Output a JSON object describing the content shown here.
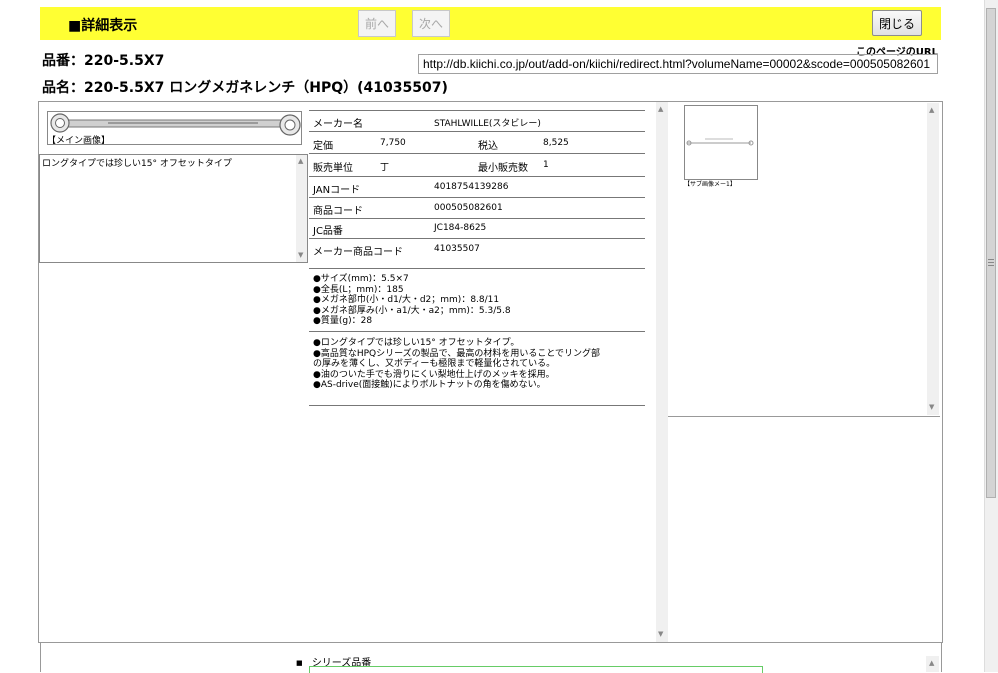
{
  "header": {
    "title": "■詳細表示",
    "prev_label": "前へ",
    "next_label": "次へ",
    "close_label": "閉じる"
  },
  "product": {
    "part_no_line": "品番：220-5.5X7",
    "part_name_line": "品名：220-5.5X7 ロングメガネレンチ（HPQ）(41035507)"
  },
  "url": {
    "label": "このページのURL",
    "value": "http://db.kiichi.co.jp/out/add-on/kiichi/redirect.html?volumeName=00002&scode=000505082601"
  },
  "main_image": {
    "caption": "【メイン画像】"
  },
  "description": "ロングタイプでは珍しい15° オフセットタイプ",
  "specs": {
    "maker_label": "メーカー名",
    "maker_value": "STAHLWILLE(スタビレー)",
    "list_price_label": "定価",
    "list_price_value": "7,750",
    "tax_in_label": "税込",
    "tax_in_value": "8,525",
    "unit_label": "販売単位",
    "unit_value": "丁",
    "min_qty_label": "最小販売数",
    "min_qty_value": "1",
    "jan_label": "JANコード",
    "jan_value": "4018754139286",
    "product_code_label": "商品コード",
    "product_code_value": "000505082601",
    "jc_label": "JC品番",
    "jc_value": "JC184-8625",
    "maker_code_label": "メーカー商品コード",
    "maker_code_value": "41035507"
  },
  "dimensions": [
    "●サイズ(mm)：5.5×7",
    "●全長(L；mm)：185",
    "●メガネ部巾(小・d1/大・d2；mm)：8.8/11",
    "●メガネ部厚み(小・a1/大・a2；mm)：5.3/5.8",
    "●質量(g)：28"
  ],
  "features": [
    "●ロングタイプでは珍しい15° オフセットタイプ。",
    "●高品質なHPQシリーズの製品で、最高の材料を用いることでリング部",
    "の厚みを薄くし、又ボディーも極限まで軽量化されている。",
    "●油のついた手でも滑りにくい梨地仕上げのメッキを採用。",
    "●AS-drive(面接触)によりボルトナットの角を傷めない。"
  ],
  "sub_image": {
    "caption": "【サブ画像メー1】"
  },
  "series": {
    "label": "シリーズ品番"
  },
  "colors": {
    "header_bg": "#ffff33",
    "series_border": "#66cc66"
  },
  "icons": [
    "wrench-image",
    "scroll-up-icon",
    "scroll-down-icon",
    "bullet-icon"
  ]
}
